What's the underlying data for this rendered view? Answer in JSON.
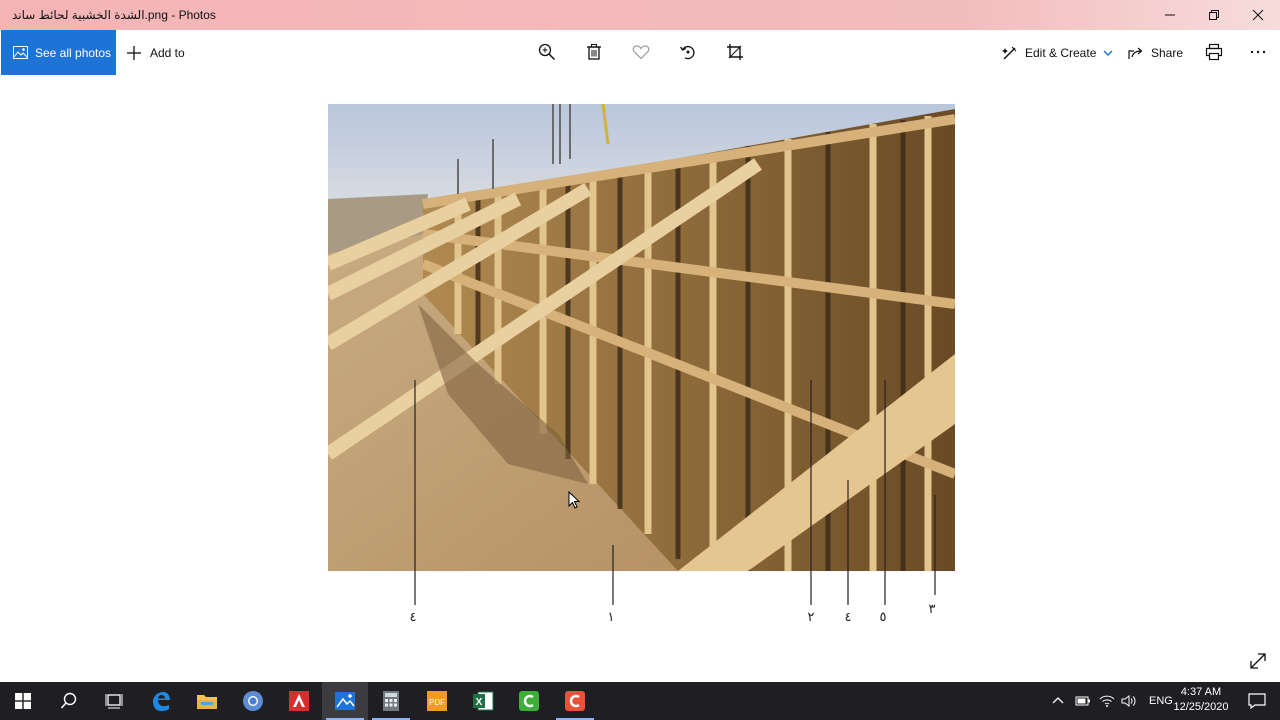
{
  "window": {
    "title": "الشدة الخشبية لحائط ساند.png - Photos"
  },
  "toolbar": {
    "see_all_label": "See all photos",
    "add_to_label": "Add to",
    "edit_create_label": "Edit & Create",
    "share_label": "Share"
  },
  "photo": {
    "labels": [
      "٤",
      "١",
      "٢",
      "٤",
      "٥",
      "٣"
    ]
  },
  "taskbar": {
    "language": "ENG",
    "time": "4:37 AM",
    "date": "12/25/2020"
  },
  "colors": {
    "titlebar": "#f4b4b6",
    "accent": "#1e73d6",
    "taskbar": "#1f1f23"
  }
}
